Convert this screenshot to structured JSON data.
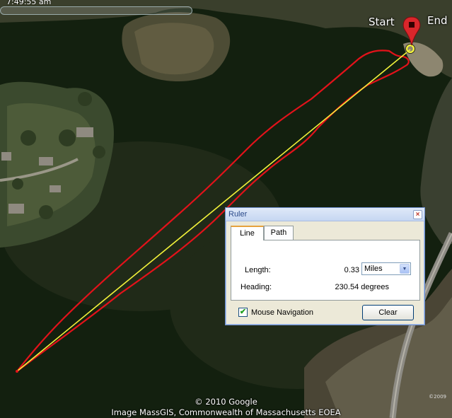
{
  "header": {
    "time_label": "7:49:55 am"
  },
  "placemarks": {
    "start_label": "Start",
    "end_label": "End"
  },
  "ruler": {
    "title": "Ruler",
    "close_symbol": "×",
    "tabs": [
      {
        "label": "Line",
        "active": true
      },
      {
        "label": "Path",
        "active": false
      }
    ],
    "length_label": "Length:",
    "length_value": "0.33",
    "units_selected": "Miles",
    "heading_label": "Heading:",
    "heading_value": "230.54 degrees",
    "mouse_navigation_label": "Mouse Navigation",
    "mouse_navigation_checked": true,
    "clear_label": "Clear"
  },
  "credits": {
    "copyright": "© 2010 Google",
    "imagery": "Image MassGIS, Commonwealth of Massachusetts EOEA",
    "corner": "©2009"
  },
  "colors": {
    "water": "#13200f",
    "path_track": "#e3121a",
    "ruler_line": "#f2f23a",
    "dialog_face": "#ece9d8",
    "dialog_border": "#6b8cc9"
  },
  "icons": {
    "pin": "red-placemark-pin-icon",
    "close": "close-icon",
    "dropdown": "chevron-down-icon",
    "check": "checkmark-icon"
  }
}
